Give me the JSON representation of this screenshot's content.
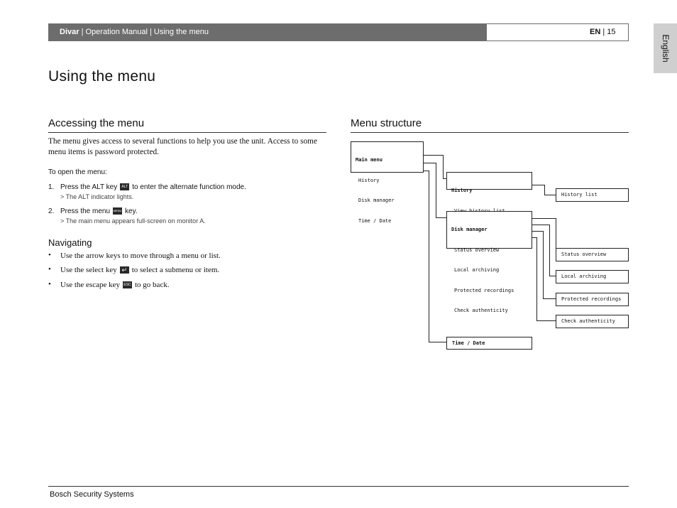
{
  "header": {
    "brand": "Divar",
    "path": " | Operation Manual | Using the menu",
    "lang_code": "EN",
    "page_sep": " | ",
    "page_number": "15",
    "language_tab": "English"
  },
  "page_title": "Using the menu",
  "accessing": {
    "heading": "Accessing the menu",
    "intro": "The menu gives access to several functions to help you use the unit. Access to some menu items is password protected.",
    "to_open": "To open the menu:",
    "steps": [
      {
        "num": "1.",
        "pre": "Press the ALT key",
        "key": "ALT",
        "post": "to enter the alternate function mode.",
        "result": "> The ALT indicator lights."
      },
      {
        "num": "2.",
        "pre": "Press the menu",
        "key": "MENU",
        "post": "key.",
        "result": "> The main menu appears full-screen on monitor A."
      }
    ]
  },
  "navigating": {
    "heading": "Navigating",
    "bullets": [
      {
        "pre": "Use the arrow keys to move through a menu or list.",
        "key": "",
        "post": ""
      },
      {
        "pre": "Use the select key",
        "key": "↵",
        "post": "to select a submenu or item."
      },
      {
        "pre": "Use the escape key",
        "key": "ESC",
        "post": "to go back."
      }
    ]
  },
  "menu_structure": {
    "heading": "Menu structure",
    "main_menu": {
      "title": "Main menu",
      "items": [
        "History",
        "Disk manager",
        "Time / Date"
      ]
    },
    "history": {
      "title": "History",
      "items": [
        "View history list"
      ]
    },
    "history_list": "History list",
    "disk_manager": {
      "title": "Disk manager",
      "items": [
        "Status overview",
        "Local archiving",
        "Protected recordings",
        "Check authenticity"
      ]
    },
    "leaves": [
      "Status overview",
      "Local archiving",
      "Protected recordings",
      "Check authenticity"
    ],
    "time_date": "Time / Date"
  },
  "footer": {
    "company": "Bosch Security Systems"
  }
}
